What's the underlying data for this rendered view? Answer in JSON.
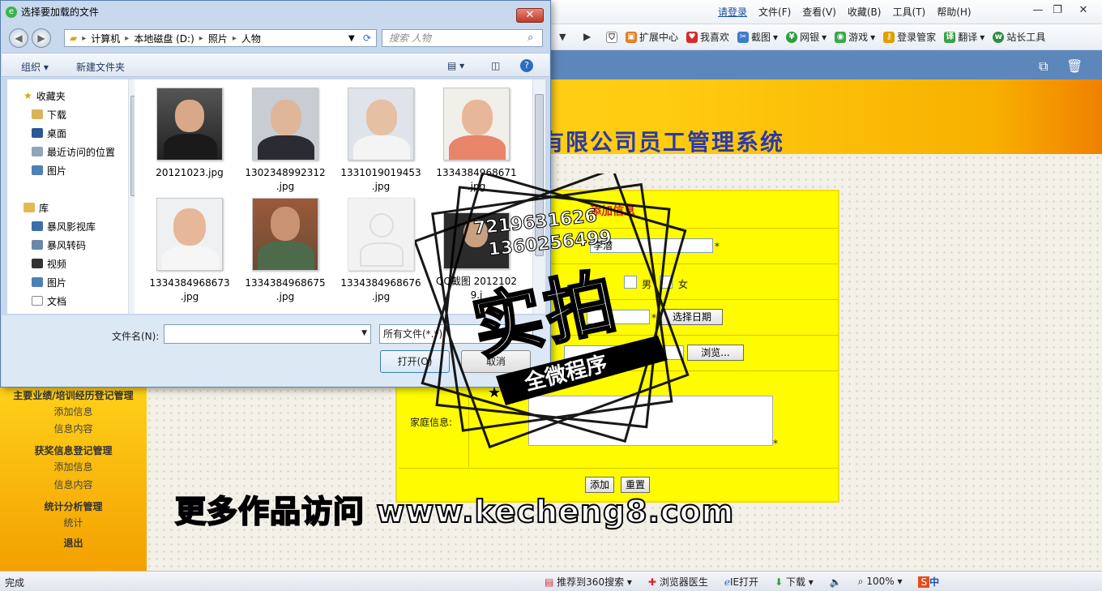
{
  "browser": {
    "login_link": "请登录",
    "menu": [
      "文件(F)",
      "查看(V)",
      "收藏(B)",
      "工具(T)",
      "帮助(H)"
    ],
    "toolbar": [
      "扩展中心",
      "我喜欢",
      "截图",
      "网银",
      "游戏",
      "登录管家",
      "翻译",
      "站长工具"
    ]
  },
  "page": {
    "banner_title": "有限公司员工管理系统",
    "sidebar": {
      "section1": "主要业绩/培训经历登记管理",
      "section1_items": [
        "添加信息",
        "信息内容"
      ],
      "section2": "获奖信息登记管理",
      "section2_items": [
        "添加信息",
        "信息内容"
      ],
      "section3": "统计分析管理",
      "section3_items": [
        "统计"
      ],
      "logout": "退出"
    },
    "form": {
      "header": "添加信息",
      "name_value": "李潜",
      "required_mark": "*",
      "gender_male": "男",
      "gender_female": "女",
      "choose_date_button": "选择日期",
      "browse_button": "浏览...",
      "family_label": "家庭信息:",
      "add_button": "添加",
      "reset_button": "重置"
    }
  },
  "dialog": {
    "title": "选择要加载的文件",
    "close_label": "✕",
    "breadcrumb": [
      "计算机",
      "本地磁盘 (D:)",
      "照片",
      "人物"
    ],
    "search_placeholder": "搜索 人物",
    "organize": "组织 ▾",
    "new_folder": "新建文件夹",
    "nav": {
      "favorites": "收藏夹",
      "favorites_items": [
        "下载",
        "桌面",
        "最近访问的位置",
        "图片"
      ],
      "libraries": "库",
      "libraries_items": [
        "暴风影视库",
        "暴风转码",
        "视频",
        "图片",
        "文档"
      ]
    },
    "files": [
      {
        "name": "20121023.jpg"
      },
      {
        "name": "1302348992312 .jpg"
      },
      {
        "name": "1331019019453 .jpg"
      },
      {
        "name": "1334384968671 .jpg"
      },
      {
        "name": "1334384968673 .jpg"
      },
      {
        "name": "1334384968675 .jpg"
      },
      {
        "name": "1334384968676 .jpg"
      },
      {
        "name": "QQ截图 2012102 9.j"
      }
    ],
    "filename_label": "文件名(N):",
    "filter_value": "所有文件(*.*)",
    "open_button": "打开(O)",
    "cancel_button": "取消"
  },
  "overlay": {
    "stamp_numbers": [
      "7219631626",
      "1360256499"
    ],
    "stamp_main": "实拍",
    "stamp_ribbon": "全微程序",
    "promo": "更多作品访问 www.kecheng8.com"
  },
  "status": {
    "text": "完成",
    "items": [
      "推荐到360搜索",
      "浏览器医生",
      "IE打开",
      "下载",
      "100%"
    ],
    "ime": "中"
  }
}
